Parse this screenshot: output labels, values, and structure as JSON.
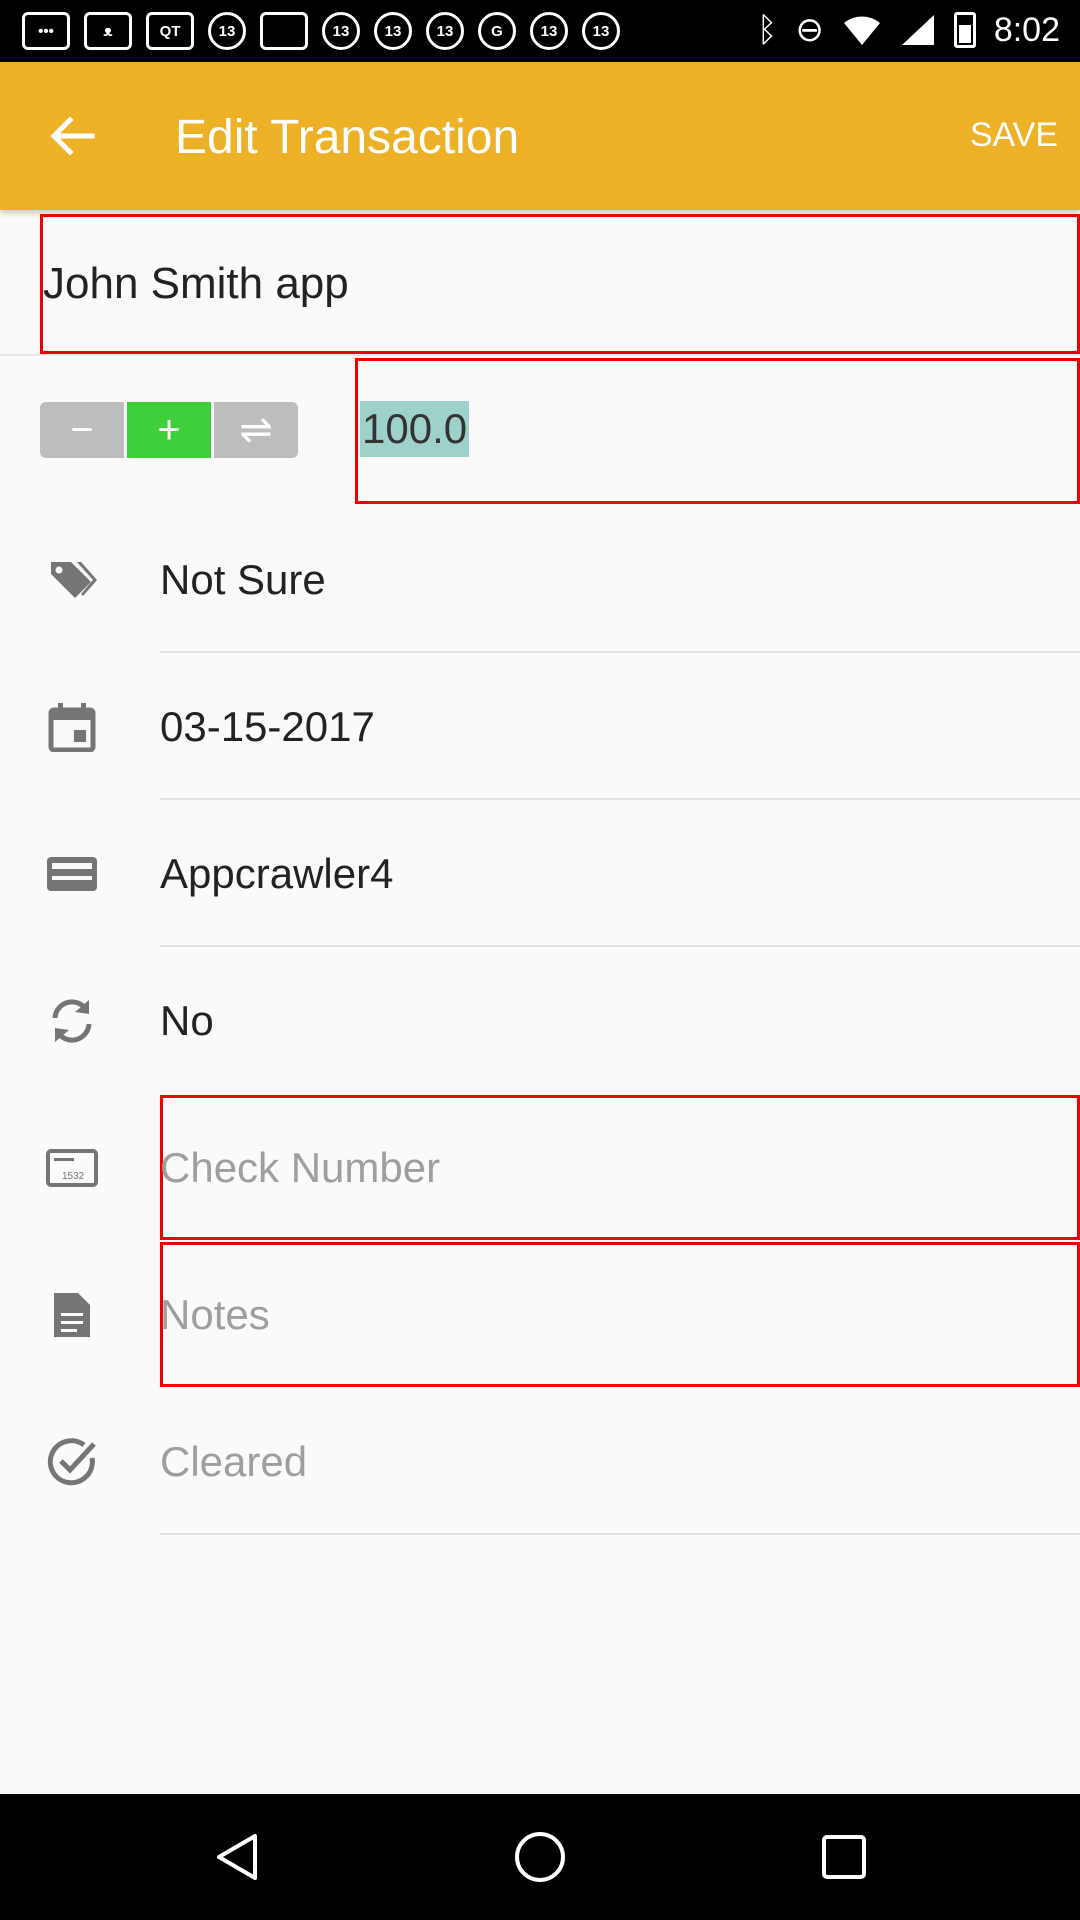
{
  "status_bar": {
    "time": "8:02",
    "left_icons": [
      "chat-icon",
      "cat-icon",
      "qt-icon",
      "abc13-icon",
      "square-icon",
      "abc13-icon",
      "abc13-icon",
      "abc13-icon",
      "google-icon",
      "abc13-icon",
      "abc13-icon"
    ],
    "qt_label": "QT",
    "abc_label": "13"
  },
  "app_bar": {
    "title": "Edit Transaction",
    "save_label": "SAVE",
    "color": "#ecb126"
  },
  "payee": {
    "value": "John Smith app"
  },
  "amount": {
    "value": "100.0",
    "segments": [
      "−",
      "+",
      "⇌"
    ],
    "selected_segment": 1
  },
  "details": {
    "category": "Not Sure",
    "date": "03-15-2017",
    "account": "Appcrawler4",
    "recurring": "No",
    "check_number_placeholder": "Check Number",
    "notes_placeholder": "Notes",
    "cleared_label": "Cleared"
  }
}
